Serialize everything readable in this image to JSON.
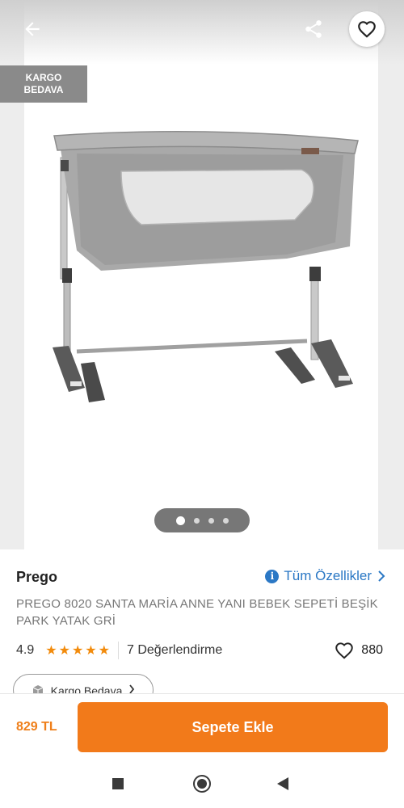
{
  "header": {
    "back_icon": "arrow-left-icon",
    "share_icon": "share-icon",
    "favorite_icon": "heart-outline-icon"
  },
  "badge": {
    "line1": "KARGO",
    "line2": "BEDAVA"
  },
  "gallery": {
    "image": "bedside-crib-product-photo",
    "total_images": 4,
    "active_index": 0
  },
  "product": {
    "brand": "Prego",
    "all_features_label": "Tüm Özellikler",
    "title": "PREGO 8020 SANTA MARİA ANNE YANI BEBEK SEPETİ BEŞİK PARK YATAK GRİ",
    "rating": "4.9",
    "stars": 5,
    "reviews_label": "7 Değerlendirme",
    "likes": "880",
    "cargo_chip_label": "Kargo Bedava"
  },
  "cart_bar": {
    "price": "829 TL",
    "add_to_cart_label": "Sepete Ekle"
  },
  "colors": {
    "accent_orange": "#f27a1a",
    "link_blue": "#2b78c5",
    "star_orange": "#f28b0c",
    "badge_gray": "#8a8a8a"
  }
}
